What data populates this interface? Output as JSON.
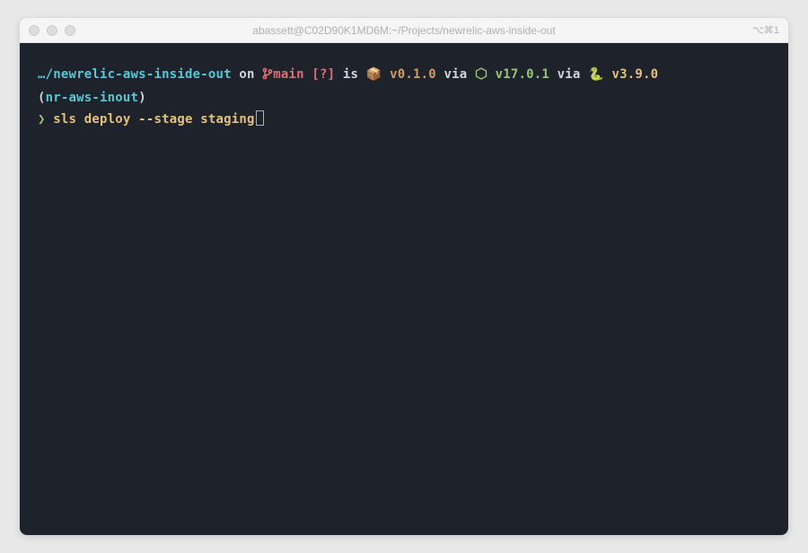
{
  "titlebar": {
    "title": "abassett@C02D90K1MD6M:~/Projects/newrelic-aws-inside-out",
    "right_label": "⌥⌘1"
  },
  "prompt": {
    "ellipsis": "…",
    "path": "/newrelic-aws-inside-out",
    "on": " on ",
    "branch_symbol": " ",
    "branch": "main",
    "status": " [?]",
    "is": " is ",
    "package_icon": "📦",
    "package_version": " v0.1.0",
    "via1": " via ",
    "node_icon": "⬢",
    "node_version": " v17.0.1",
    "via2": " via ",
    "python_icon": "🐍",
    "python_version": " v3.9.0"
  },
  "prompt2": {
    "open": "(",
    "env": "nr-aws-inout",
    "close": ")"
  },
  "command": {
    "char": "❯",
    "text": " sls deploy --stage staging"
  },
  "colors": {
    "cyan": "#56c7d6",
    "red": "#e06c75",
    "orange": "#d19a66",
    "yellow": "#e5c07b",
    "green": "#98c379",
    "white": "#d0d4db",
    "background": "#1e222a"
  }
}
